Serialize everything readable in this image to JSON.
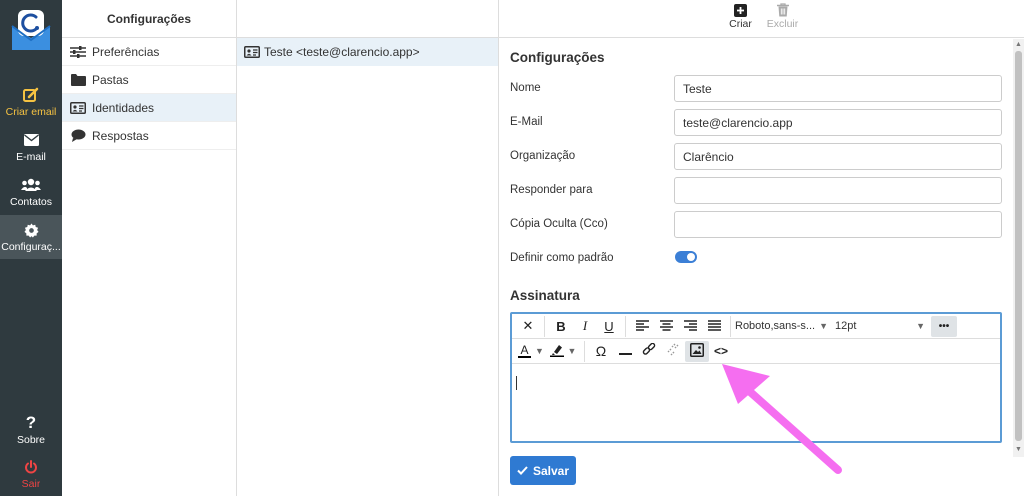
{
  "nav": {
    "items": [
      {
        "label": "Criar email",
        "icon": "pencil-square-icon"
      },
      {
        "label": "E-mail",
        "icon": "envelope-icon"
      },
      {
        "label": "Contatos",
        "icon": "users-icon"
      },
      {
        "label": "Configuraç...",
        "icon": "gear-icon"
      },
      {
        "label": "Sobre",
        "icon": "question-icon"
      },
      {
        "label": "Sair",
        "icon": "power-icon"
      }
    ]
  },
  "settings": {
    "header": "Configurações",
    "items": [
      {
        "label": "Preferências",
        "icon": "sliders-icon"
      },
      {
        "label": "Pastas",
        "icon": "folder-icon"
      },
      {
        "label": "Identidades",
        "icon": "id-card-icon"
      },
      {
        "label": "Respostas",
        "icon": "comment-icon"
      }
    ]
  },
  "identities": {
    "items": [
      {
        "label": "Teste <teste@clarencio.app>",
        "icon": "id-card-icon"
      }
    ]
  },
  "toolbar": {
    "create_label": "Criar",
    "delete_label": "Excluir"
  },
  "form": {
    "title": "Configurações",
    "fields": [
      {
        "label": "Nome",
        "value": "Teste"
      },
      {
        "label": "E-Mail",
        "value": "teste@clarencio.app"
      },
      {
        "label": "Organização",
        "value": "Clarêncio"
      },
      {
        "label": "Responder para",
        "value": ""
      },
      {
        "label": "Cópia Oculta (Cco)",
        "value": ""
      }
    ],
    "default_label": "Definir como padrão",
    "default_on": true,
    "signature_title": "Assinatura",
    "editor": {
      "font_family": "Roboto,sans-s...",
      "font_size": "12pt",
      "omega_symbol": "Ω",
      "bold": "B",
      "italic": "I",
      "underline": "U",
      "close": "✕",
      "more": "•••",
      "font_color_letter": "A",
      "code": "<>"
    },
    "save_label": "Salvar"
  },
  "colors": {
    "nav_bg": "#2f3a3f",
    "primary": "#2f7ad2",
    "annotation_arrow": "#f56ef0"
  }
}
